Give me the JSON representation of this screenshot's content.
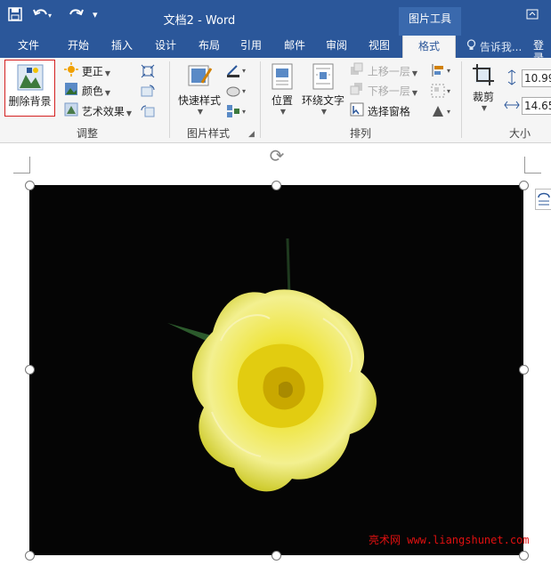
{
  "window": {
    "title": "文档2 - Word",
    "context_tools": "图片工具"
  },
  "tabs": [
    "文件",
    "开始",
    "插入",
    "设计",
    "布局",
    "引用",
    "邮件",
    "审阅",
    "视图",
    "格式"
  ],
  "active_tab": "格式",
  "tell_me": "告诉我...",
  "login": "登录",
  "ribbon": {
    "remove_bg": "删除背景",
    "corrections": "更正",
    "color": "颜色",
    "artistic": "艺术效果",
    "adjust_group": "调整",
    "quick_styles": "快速样式",
    "picture_styles_group": "图片样式",
    "position": "位置",
    "wrap_text": "环绕文字",
    "bring_forward": "上移一层",
    "send_backward": "下移一层",
    "selection_pane": "选择窗格",
    "arrange_group": "排列",
    "crop": "裁剪",
    "height": "10.99",
    "width": "14.65",
    "size_group": "大小"
  },
  "watermark": "亮术网 www.liangshunet.com",
  "colors": {
    "ribbon_blue": "#2b579a",
    "rose_yellow": "#e8e020",
    "highlight_red": "#d42020"
  }
}
